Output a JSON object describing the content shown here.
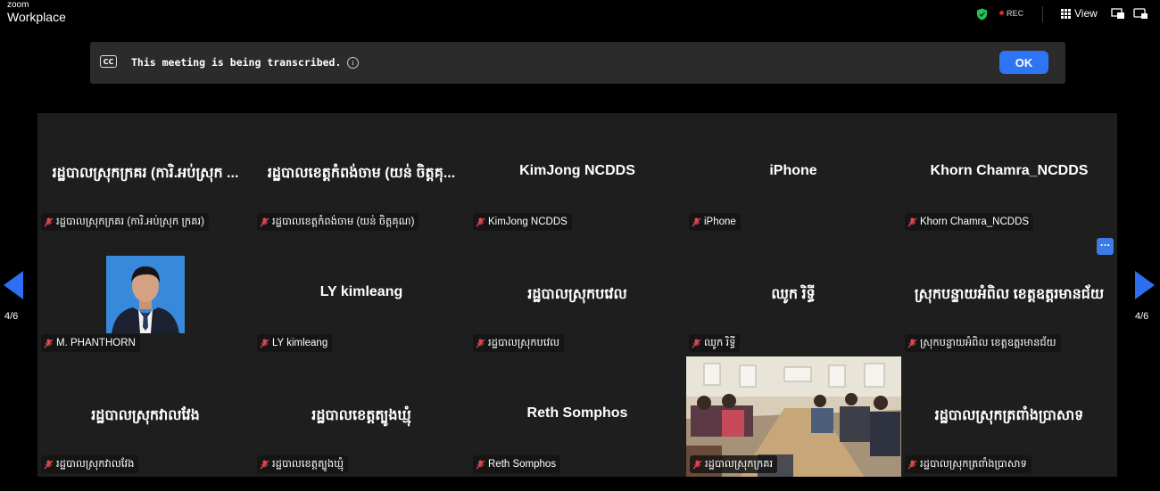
{
  "app": {
    "logo_line1": "zoom",
    "logo_line2": "Workplace"
  },
  "topbar": {
    "rec_label": "REC",
    "view_label": "View"
  },
  "banner": {
    "text": "This meeting is being transcribed.",
    "cc_label": "CC",
    "info_glyph": "i",
    "ok_label": "OK"
  },
  "page_indicator": {
    "left": "4/6",
    "right": "4/6"
  },
  "more_button_label": "...",
  "participants": [
    {
      "display": "រដ្ឋបាលស្រុកក្រគរ (ការិ.អប់ស្រុក ...",
      "tag": "រដ្ឋបាលស្រុកក្រគរ (ការិ.អប់ស្រុក ក្រគរ)"
    },
    {
      "display": "រដ្ឋបាលខេត្តកំពង់ចាម (យន់ ចិត្តគុ...",
      "tag": "រដ្ឋបាលខេត្តកំពង់ចាម (យន់ ចិត្តគុណ)"
    },
    {
      "display": "KimJong NCDDS",
      "tag": "KimJong NCDDS"
    },
    {
      "display": "iPhone",
      "tag": "iPhone"
    },
    {
      "display": "Khorn Chamra_NCDDS",
      "tag": "Khorn Chamra_NCDDS"
    },
    {
      "display": "",
      "tag": "M. PHANTHORN"
    },
    {
      "display": "LY kimleang",
      "tag": "LY kimleang"
    },
    {
      "display": "រដ្ឋបាលស្រុកបវេល",
      "tag": "រដ្ឋបាលស្រុកបវេល"
    },
    {
      "display": "ឈូក រិទ្ធី",
      "tag": "ឈូក រិទ្ធី"
    },
    {
      "display": "ស្រុកបន្ទាយអំពិល ខេត្តឧត្តរមានជ័យ",
      "tag": "ស្រុកបន្ទាយអំពិល ខេត្តឧត្តរមានជ័យ"
    },
    {
      "display": "រដ្ឋបាលស្រុកវាលវែង",
      "tag": "រដ្ឋបាលស្រុកវាលវែង"
    },
    {
      "display": "រដ្ឋបាលខេត្តត្បូងឃ្មុំ",
      "tag": "រដ្ឋបាលខេត្តត្បូងឃ្មុំ"
    },
    {
      "display": "Reth Somphos",
      "tag": "Reth Somphos"
    },
    {
      "display": "",
      "tag": "រដ្ឋបាលស្រុកក្រគរ"
    },
    {
      "display": "រដ្ឋបាលស្រុកត្រពាំងប្រាសាទ",
      "tag": "រដ្ឋបាលស្រុកត្រពាំងប្រាសាទ"
    }
  ],
  "colors": {
    "accent": "#2d75f5",
    "background": "#000000",
    "tile": "#1e1e1e",
    "muted_mic": "#e0474c",
    "secure": "#23c552"
  }
}
